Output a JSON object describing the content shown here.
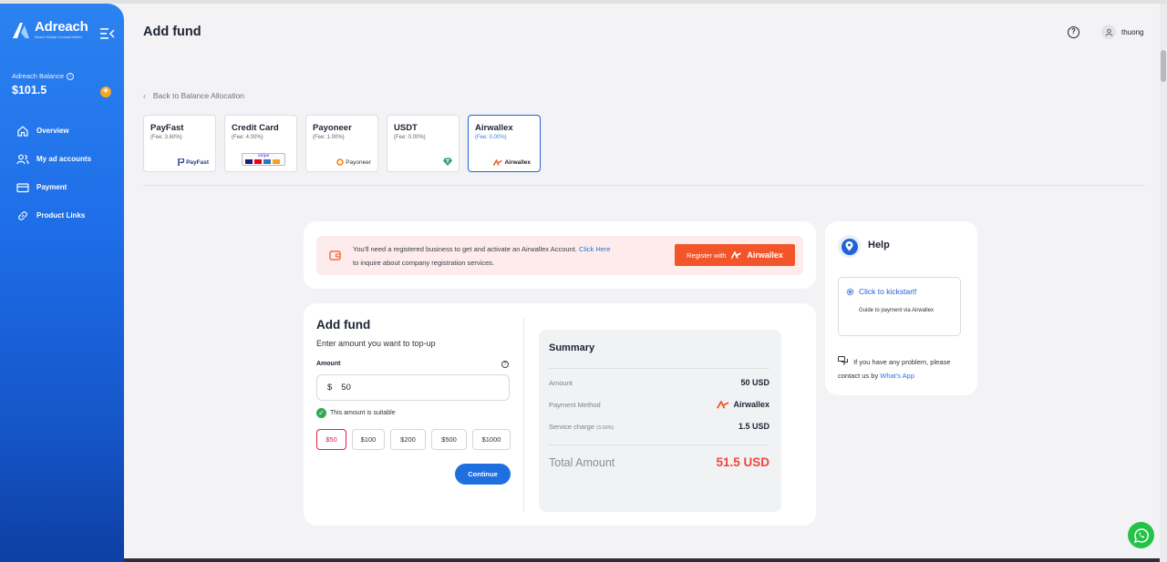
{
  "app": {
    "brand": "Adreach",
    "brand_tagline": "Reach Global Connect Better"
  },
  "sidebar": {
    "balance_label": "Adreach Balance",
    "balance_value": "$101.5",
    "items": [
      {
        "label": "Overview",
        "icon": "home-icon"
      },
      {
        "label": "My ad accounts",
        "icon": "users-icon"
      },
      {
        "label": "Payment",
        "icon": "card-icon"
      },
      {
        "label": "Product Links",
        "icon": "link-icon"
      }
    ]
  },
  "header": {
    "title": "Add fund",
    "help_symbol": "?",
    "user_name": "thuong"
  },
  "back_link": {
    "arrow": "‹",
    "label": "Back to Balance Allocation"
  },
  "methods": [
    {
      "name": "PayFast",
      "fee": "(Fee: 3.60%)",
      "logo": "PayFast"
    },
    {
      "name": "Credit Card",
      "fee": "(Fee: 4.00%)",
      "logo": "stripe"
    },
    {
      "name": "Payoneer",
      "fee": "(Fee: 1.00%)",
      "logo": "Payoneer"
    },
    {
      "name": "USDT",
      "fee": "(Fee: 0.00%)",
      "logo": ""
    },
    {
      "name": "Airwallex",
      "fee": "(Fee: 0.00%)",
      "logo": "Airwallex"
    }
  ],
  "notice": {
    "text_before": "You'll need a registered business to get and activate an Airwallex Account.",
    "link": "Click Here",
    "text_after": "to inquire about company registration services.",
    "button_label": "Register with",
    "button_brand": "Airwallex"
  },
  "fund": {
    "title": "Add fund",
    "subtitle": "Enter amount you want to top-up",
    "amount_label": "Amount",
    "currency": "$",
    "amount_value": "50",
    "suitable_text": "This amount is suitable",
    "presets": [
      "$50",
      "$100",
      "$200",
      "$500",
      "$1000"
    ],
    "selected_preset": "$50",
    "continue_label": "Continue"
  },
  "summary": {
    "title": "Summary",
    "amount_label": "Amount",
    "amount_value": "50 USD",
    "method_label": "Payment Method",
    "method_value": "Airwallex",
    "charge_label": "Service charge",
    "charge_rate": "(3.00%)",
    "charge_value": "1.5 USD",
    "total_label": "Total Amount",
    "total_value": "51.5 USD"
  },
  "help": {
    "title": "Help",
    "kickstart_title": "Click to kickstart!",
    "kickstart_desc": "Guide to payment via Airwallex",
    "contact_text": "If you have any problem, please contact us by",
    "contact_link": "What's App"
  },
  "colors": {
    "primary": "#1f6fe0",
    "accent_orange": "#f3552b",
    "total_red": "#f0453a",
    "selected_red": "#d9234a",
    "success": "#34a853"
  }
}
